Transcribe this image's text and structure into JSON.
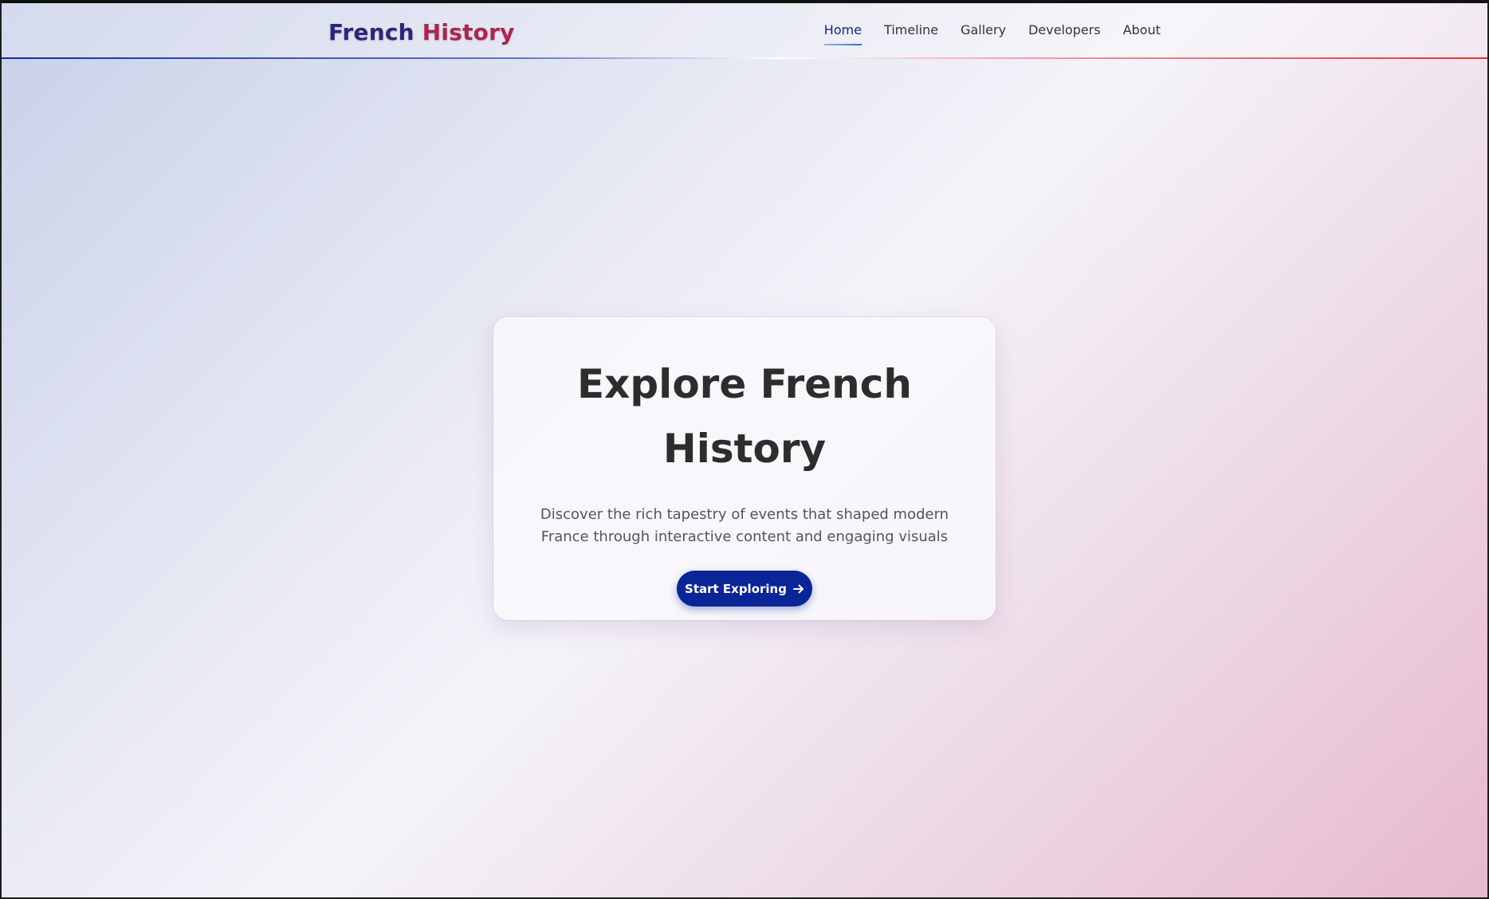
{
  "header": {
    "logo_part1": "French",
    "logo_part2": "History",
    "nav": [
      {
        "label": "Home",
        "active": true
      },
      {
        "label": "Timeline",
        "active": false
      },
      {
        "label": "Gallery",
        "active": false
      },
      {
        "label": "Developers",
        "active": false
      },
      {
        "label": "About",
        "active": false
      }
    ]
  },
  "hero": {
    "title": "Explore French History",
    "subtitle": "Discover the rich tapestry of events that shaped modern France through interactive content and engaging visuals",
    "cta_label": "Start Exploring",
    "cta_icon": "arrow-right-icon"
  },
  "colors": {
    "primary": "#0a2597",
    "logo_blue": "#2a2779",
    "logo_red": "#b0234e",
    "accent_red": "#e23137"
  }
}
